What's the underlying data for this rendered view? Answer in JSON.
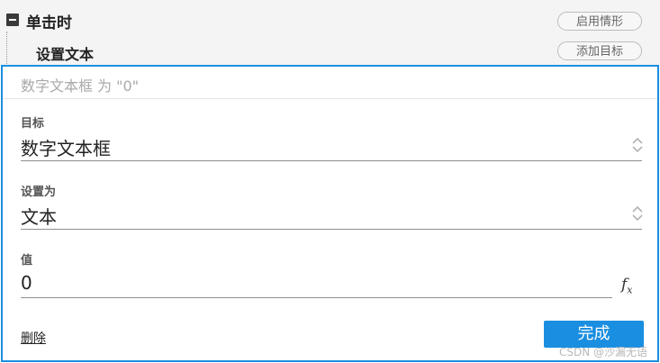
{
  "header": {
    "event_title": "单击时",
    "action_title": "设置文本",
    "enable_case_label": "启用情形",
    "add_target_label": "添加目标"
  },
  "action_panel": {
    "summary": "数字文本框 为 \"0\"",
    "target": {
      "label": "目标",
      "value": "数字文本框"
    },
    "set_as": {
      "label": "设置为",
      "value": "文本"
    },
    "value": {
      "label": "值",
      "value": "0"
    },
    "delete_label": "删除",
    "done_label": "完成"
  },
  "watermark": "CSDN @沙漏无语",
  "colors": {
    "accent": "#1a8ee0",
    "header_bg": "#f4f4f4"
  },
  "icons": [
    "collapse-icon",
    "updown-icon",
    "fx-icon"
  ]
}
